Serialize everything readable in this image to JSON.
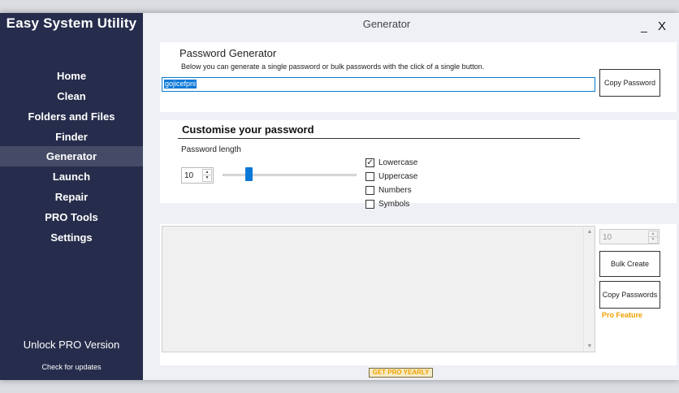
{
  "app": {
    "title": "Easy System Utility"
  },
  "window": {
    "title": "Generator",
    "minimize_label": "_",
    "close_label": "X"
  },
  "sidebar": {
    "items": [
      {
        "label": "Home"
      },
      {
        "label": "Clean"
      },
      {
        "label": "Folders and Files"
      },
      {
        "label": "Finder"
      },
      {
        "label": "Generator",
        "active": true
      },
      {
        "label": "Launch"
      },
      {
        "label": "Repair"
      },
      {
        "label": "PRO Tools"
      },
      {
        "label": "Settings"
      }
    ],
    "unlock_label": "Unlock PRO Version",
    "check_updates_label": "Check for updates"
  },
  "generator": {
    "title": "Password Generator",
    "subtitle": "Below you can generate a single password or bulk passwords with the click of a single button.",
    "password_value": "gojicefpni",
    "copy_button": "Copy Password"
  },
  "customise": {
    "title": "Customise your password",
    "length_label": "Password length",
    "length_value": "10",
    "slider_fraction": 0.18,
    "options": [
      {
        "label": "Lowercase",
        "checked": true
      },
      {
        "label": "Uppercase",
        "checked": false
      },
      {
        "label": "Numbers",
        "checked": false
      },
      {
        "label": "Symbols",
        "checked": false
      }
    ]
  },
  "bulk": {
    "count_value": "10",
    "create_button": "Bulk Create",
    "copy_button": "Copy Passwords",
    "pro_feature_label": "Pro Feature"
  },
  "footer": {
    "get_pro_label": "GET PRO YEARLY"
  },
  "colors": {
    "sidebar_bg": "#262d4c",
    "sidebar_active": "#454b66",
    "accent": "#0a78d7",
    "pro_orange": "#f2a000"
  }
}
